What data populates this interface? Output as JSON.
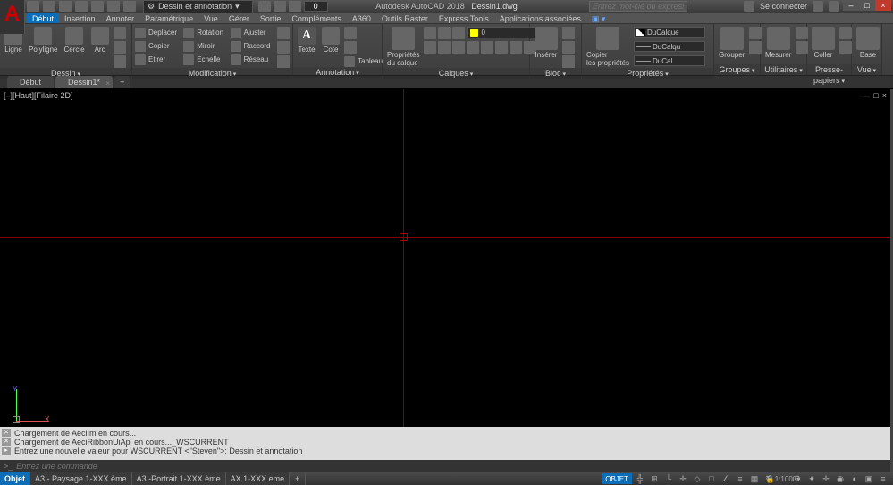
{
  "title": {
    "app": "Autodesk AutoCAD 2018",
    "doc": "Dessin1.dwg"
  },
  "workspace": "Dessin et annotation",
  "qat_number": "0",
  "search_placeholder": "Entrez mot-clé ou expression",
  "user": {
    "connect": "Se connecter"
  },
  "menu": [
    "Début",
    "Insertion",
    "Annoter",
    "Paramétrique",
    "Vue",
    "Gérer",
    "Sortie",
    "Compléments",
    "A360",
    "Outils Raster",
    "Express Tools",
    "Applications associées"
  ],
  "ribbon": {
    "draw": {
      "title": "Dessin",
      "ligne": "Ligne",
      "poly": "Polyligne",
      "cercle": "Cercle",
      "arc": "Arc"
    },
    "modify": {
      "title": "Modification",
      "deplacer": "Déplacer",
      "rotation": "Rotation",
      "ajuster": "Ajuster",
      "copier": "Copier",
      "miroir": "Miroir",
      "raccord": "Raccord",
      "etirer": "Etirer",
      "echelle": "Echelle",
      "reseau": "Réseau"
    },
    "annot": {
      "title": "Annotation",
      "texte": "Texte",
      "cote": "Cote",
      "tableau": "Tableau"
    },
    "layers": {
      "title": "Calques",
      "props": "Propriétés\ndu calque",
      "current": "0"
    },
    "block": {
      "title": "Bloc",
      "inserer": "Insérer"
    },
    "props": {
      "title": "Propriétés",
      "copier": "Copier\nles propriétés",
      "c1": "DuCalque",
      "c2": "DuCalqu",
      "c3": "DuCal"
    },
    "groups": {
      "title": "Groupes",
      "grouper": "Grouper"
    },
    "util": {
      "title": "Utilitaires",
      "mesurer": "Mesurer"
    },
    "clip": {
      "title": "Presse-papiers",
      "coller": "Coller"
    },
    "view": {
      "title": "Vue",
      "base": "Base"
    }
  },
  "doctabs": {
    "start": "Début",
    "d1": "Dessin1*"
  },
  "viewlabel": "[–][Haut][Filaire 2D]",
  "ucs": {
    "x": "X",
    "y": "Y"
  },
  "cmd": {
    "l1": "Chargement de AeciIm en cours...",
    "l2": "Chargement de AeciRibbonUiApi en cours..._WSCURRENT",
    "l3": "Entrez une nouvelle valeur pour WSCURRENT <\"Steven\">: Dessin et annotation",
    "prompt": ">_",
    "placeholder": "Entrez une commande"
  },
  "status": {
    "objet": "Objet",
    "layouts": [
      "A3 - Paysage 1-XXX ème",
      "A3 -Portrait 1-XXX ème",
      "AX 1-XXX eme"
    ],
    "model_btn": "OBJET",
    "scale": "1:1000"
  }
}
